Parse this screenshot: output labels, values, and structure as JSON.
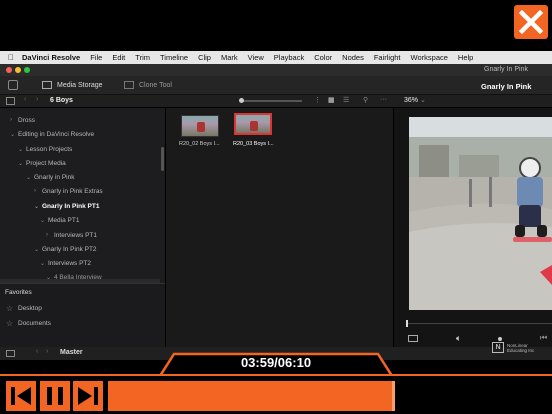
{
  "menubar": {
    "app_name": "DaVinci Resolve",
    "items": [
      "File",
      "Edit",
      "Trim",
      "Timeline",
      "Clip",
      "Mark",
      "View",
      "Playback",
      "Color",
      "Nodes",
      "Fairlight",
      "Workspace",
      "Help"
    ]
  },
  "window": {
    "title": "Gnarly In Pink"
  },
  "toolbar": {
    "media_storage": "Media Storage",
    "clone_tool": "Clone Tool",
    "project_title": "Gnarly In Pink"
  },
  "toolbar2": {
    "bin_name": "6 Boys",
    "zoom": "36%"
  },
  "tree": {
    "items": [
      {
        "label": "Dross",
        "depth": 1,
        "arrow": "›"
      },
      {
        "label": "Editing in DaVinci Resolve",
        "depth": 1,
        "arrow": "⌄"
      },
      {
        "label": "Lesson Projects",
        "depth": 2,
        "arrow": "⌄"
      },
      {
        "label": "Project Media",
        "depth": 2,
        "arrow": "⌄"
      },
      {
        "label": "Gnarly in Pink",
        "depth": 3,
        "arrow": "⌄"
      },
      {
        "label": "Gnarly in Pink Extras",
        "depth": 4,
        "arrow": "›"
      },
      {
        "label": "Gnarly In Pink PT1",
        "depth": 4,
        "arrow": "⌄",
        "selected": true
      },
      {
        "label": "Media PT1",
        "depth": 5,
        "arrow": "⌄"
      },
      {
        "label": "Interviews PT1",
        "depth": 6,
        "arrow": "›"
      },
      {
        "label": "Gnarly In Pink PT2",
        "depth": 4,
        "arrow": "⌄"
      },
      {
        "label": "Interviews PT2",
        "depth": 5,
        "arrow": "⌄"
      },
      {
        "label": "4 Bella Interview",
        "depth": 6,
        "arrow": "⌄"
      }
    ]
  },
  "favorites": {
    "title": "Favorites",
    "items": [
      "Desktop",
      "Documents"
    ]
  },
  "media_pool": {
    "clips": [
      {
        "label": "R20_02 Boys I...",
        "selected": false
      },
      {
        "label": "R20_03 Boys I...",
        "selected": true
      }
    ]
  },
  "bottom_strip": {
    "timeline_name": "Master"
  },
  "player": {
    "timecode": "03:59/06:10",
    "progress": 0.647,
    "accent": "#f26522"
  },
  "watermark": {
    "line1": "NonLinear",
    "line2": "Educating Inc"
  },
  "icons": [
    "close-icon",
    "apple-icon",
    "skip-back-icon",
    "pause-icon",
    "skip-forward-icon",
    "volume-icon"
  ]
}
